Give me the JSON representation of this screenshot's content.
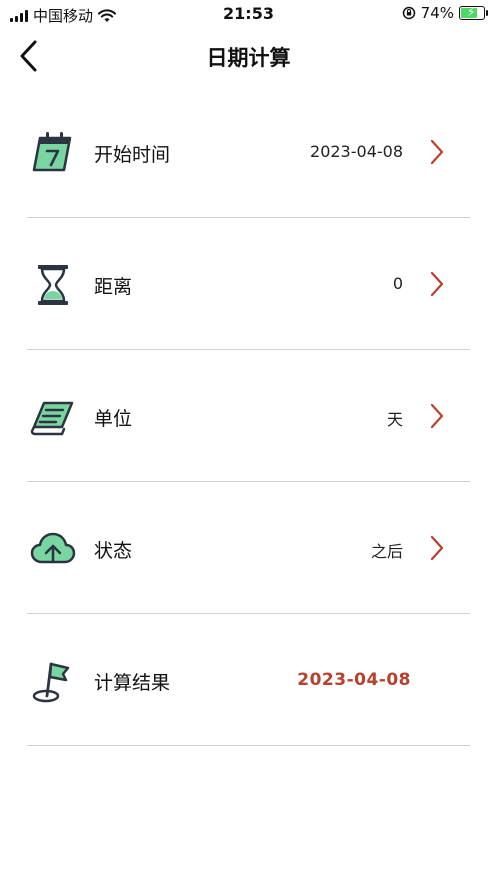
{
  "status_bar": {
    "carrier": "中国移动",
    "time": "21:53",
    "battery": "74%",
    "battery_level": 0.74
  },
  "header": {
    "title": "日期计算"
  },
  "rows": [
    {
      "label": "开始时间",
      "value": "2023-04-08",
      "icon": "calendar-icon"
    },
    {
      "label": "距离",
      "value": "0",
      "icon": "hourglass-icon"
    },
    {
      "label": "单位",
      "value": "天",
      "icon": "book-icon"
    },
    {
      "label": "状态",
      "value": "之后",
      "icon": "cloud-upload-icon"
    },
    {
      "label": "计算结果",
      "value": "2023-04-08",
      "icon": "flag-icon"
    }
  ],
  "colors": {
    "accent_green": "#7ad6a1",
    "icon_dark": "#2b3440",
    "chevron_red": "#b7402e",
    "result_red": "#b7402e"
  }
}
